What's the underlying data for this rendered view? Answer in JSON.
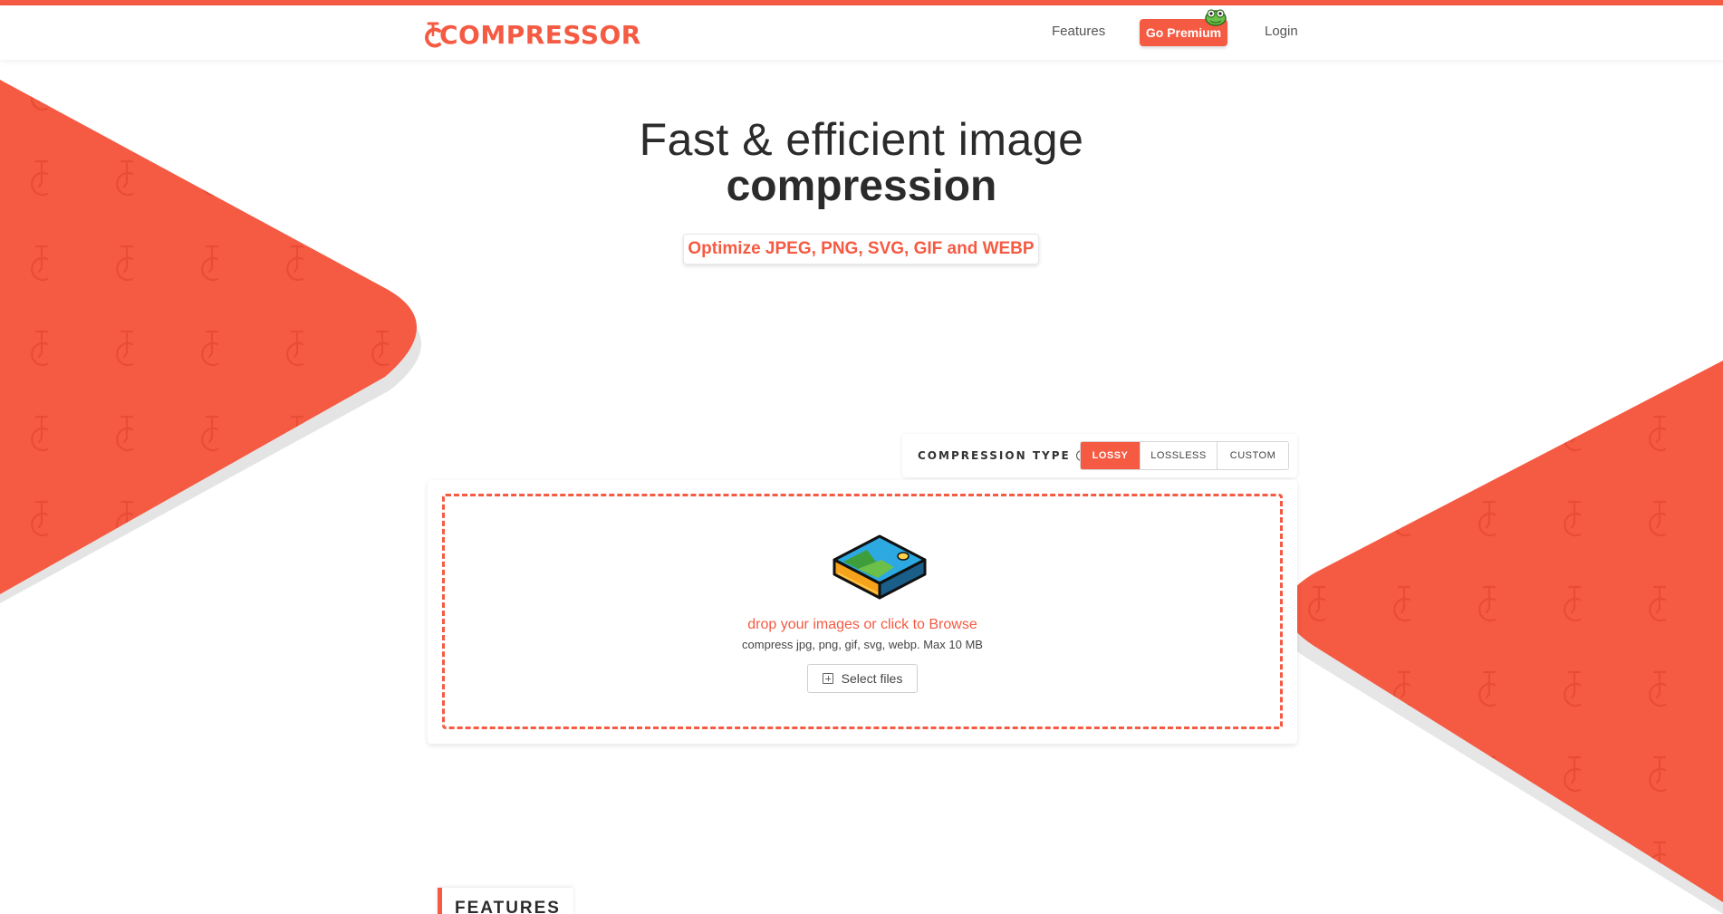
{
  "brand": {
    "name": "COMPRESSOR",
    "accent_color": "#f55a42"
  },
  "nav": {
    "features_label": "Features",
    "premium_label": "Go Premium",
    "login_label": "Login"
  },
  "hero": {
    "title_line1": "Fast & efficient image",
    "title_line2": "compression",
    "formats_pill": "Optimize JPEG, PNG, SVG, GIF and WEBP"
  },
  "compression_type": {
    "label": "COMPRESSION TYPE",
    "help_icon": "question-circle-icon",
    "suffix": ":",
    "options": [
      {
        "label": "LOSSY",
        "active": true
      },
      {
        "label": "LOSSLESS",
        "active": false
      },
      {
        "label": "CUSTOM",
        "active": false
      }
    ]
  },
  "uploader": {
    "illustration": "image-file-icon",
    "drop_text": "drop your images or click to Browse",
    "hint_text": "compress jpg, png, gif, svg, webp. Max 10 MB",
    "select_label": "Select files",
    "select_icon": "add-file-icon"
  },
  "features_section": {
    "heading": "FEATURES"
  }
}
